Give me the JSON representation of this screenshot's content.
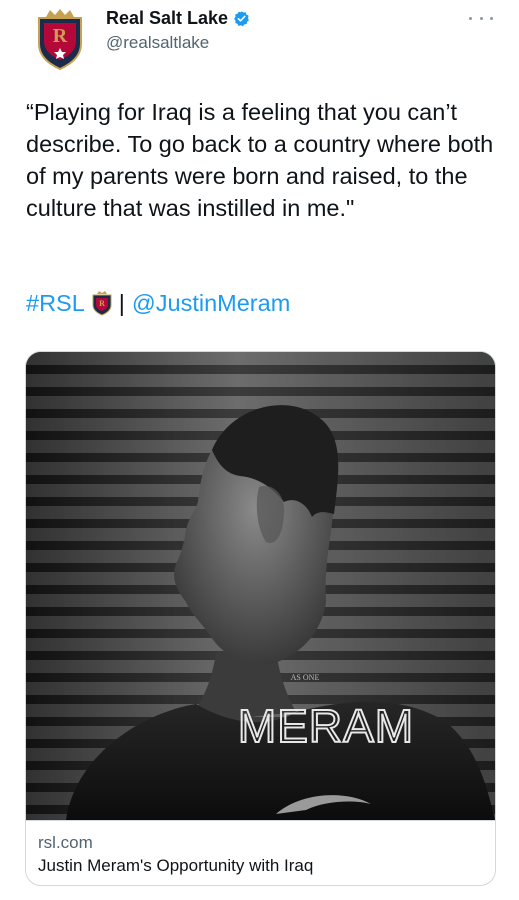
{
  "account": {
    "name": "Real Salt Lake",
    "handle": "@realsaltlake",
    "logo_letter": "R"
  },
  "tweet": {
    "text": "“Playing for Iraq is a feeling that you can’t describe. To go back to a country where both of my parents were born and raised, to the culture that was instilled in me.\"",
    "hashtag": "#RSL",
    "separator": "|",
    "mention": "@JustinMeram"
  },
  "card": {
    "domain": "rsl.com",
    "title": "Justin Meram's Opportunity with Iraq",
    "jersey_small_text": "AS ONE",
    "jersey_name": "MERAM"
  },
  "colors": {
    "link": "#1d9bf0",
    "verified": "#1d9bf0",
    "logo_navy": "#1b2b4b",
    "logo_gold": "#c6a152",
    "logo_red": "#b30838"
  },
  "icons": {
    "verified": "verified-badge-icon",
    "more": "more-options-icon",
    "avatar": "rsl-crest-logo",
    "emoji": "rsl-shield-emoji"
  }
}
